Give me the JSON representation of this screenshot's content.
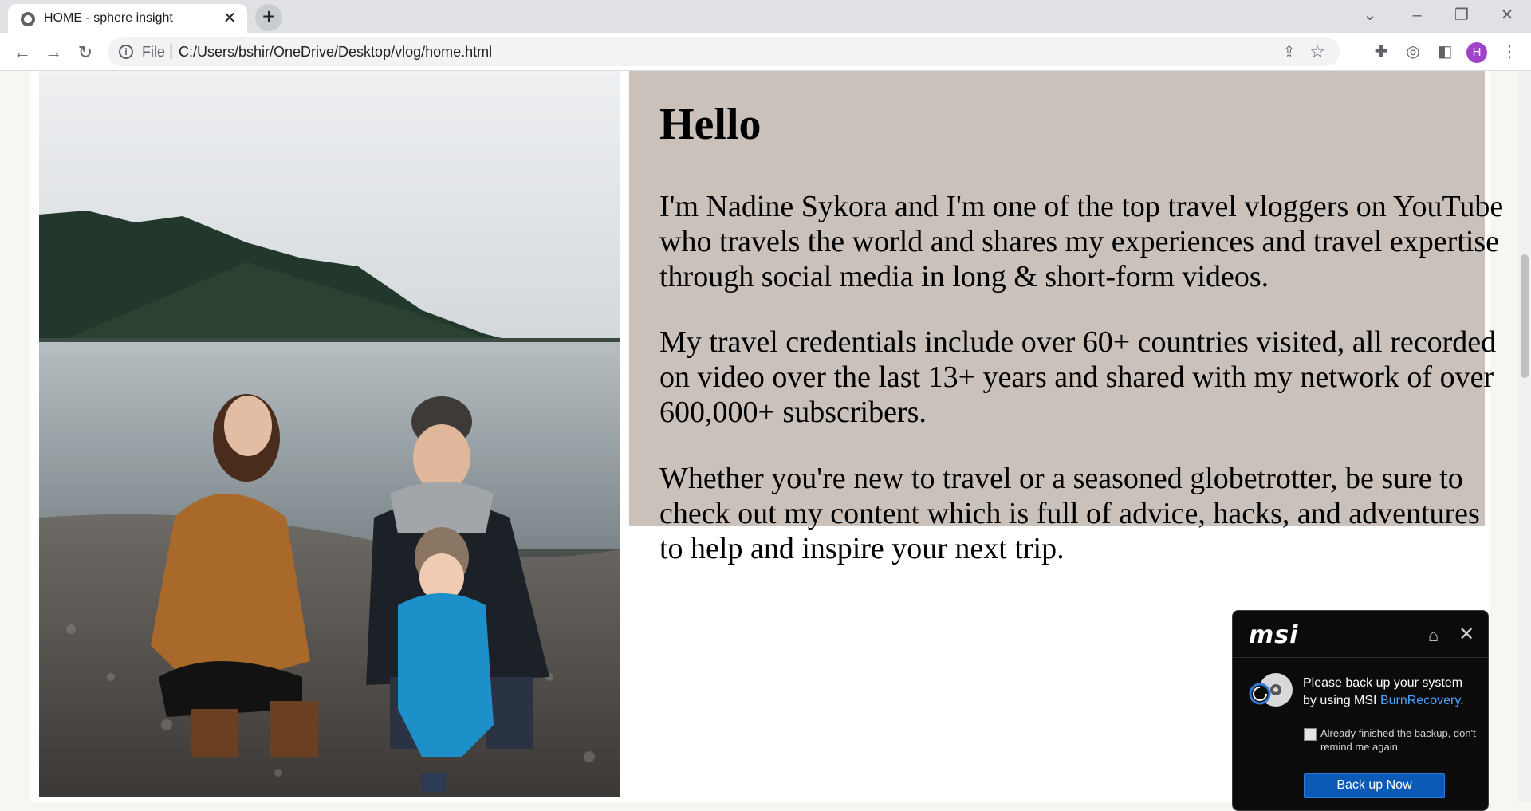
{
  "browser": {
    "tab_title": "HOME - sphere insight",
    "tab_close": "✕",
    "new_tab": "+",
    "url_scheme": "File",
    "url_separator": "|",
    "url": "C:/Users/bshir/OneDrive/Desktop/vlog/home.html",
    "profile_initial": "H"
  },
  "page": {
    "heading": "Hello",
    "paragraphs": [
      "I'm Nadine Sykora and I'm one of the top travel vloggers on YouTube who travels the world and shares my experiences and travel expertise through social media in long & short-form videos.",
      "My travel credentials include over 60+ countries visited, all recorded on video over the last 13+ years and shared with my network of over 600,000+ subscribers.",
      "Whether you're new to travel or a seasoned globetrotter, be sure to check out my content which is full of advice, hacks, and adventures to help and inspire your next trip."
    ]
  },
  "msi_popup": {
    "logo": "msi",
    "message_prefix": "Please back up your system by using MSI ",
    "message_link": "BurnRecovery",
    "message_suffix": ".",
    "checkbox_label": "Already finished the backup, don't remind me again.",
    "checkbox_checked": false,
    "button_label": "Back up Now"
  },
  "colors": {
    "panel_bg": "#c9c1ba",
    "page_bg": "#f8f6f3",
    "msi_accent": "#0b5bb6",
    "link_blue": "#4aa3ff"
  }
}
